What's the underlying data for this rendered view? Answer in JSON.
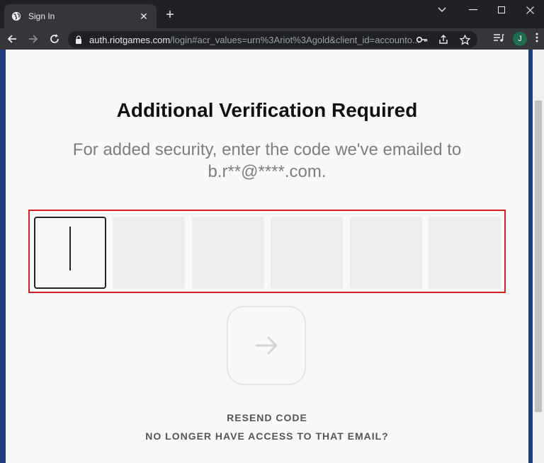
{
  "browser": {
    "tab_title": "Sign In",
    "tab_close": "✕",
    "new_tab": "+",
    "url_host": "auth.riotgames.com",
    "url_path": "/login#acr_values=urn%3Ariot%3Agold&client_id=accounto...",
    "avatar_letter": "J"
  },
  "page": {
    "title": "Additional Verification Required",
    "subtitle_line1": "For added security, enter the code we've emailed to",
    "subtitle_line2": "b.r**@****.com.",
    "digits": [
      "",
      "",
      "",
      "",
      "",
      ""
    ],
    "resend_label": "RESEND CODE",
    "no_access_label": "NO LONGER HAVE ACCESS TO THAT EMAIL?"
  },
  "colors": {
    "highlight_frame": "#d31f1f",
    "page_bg": "#f9f9f9",
    "chrome_bg": "#202124"
  }
}
